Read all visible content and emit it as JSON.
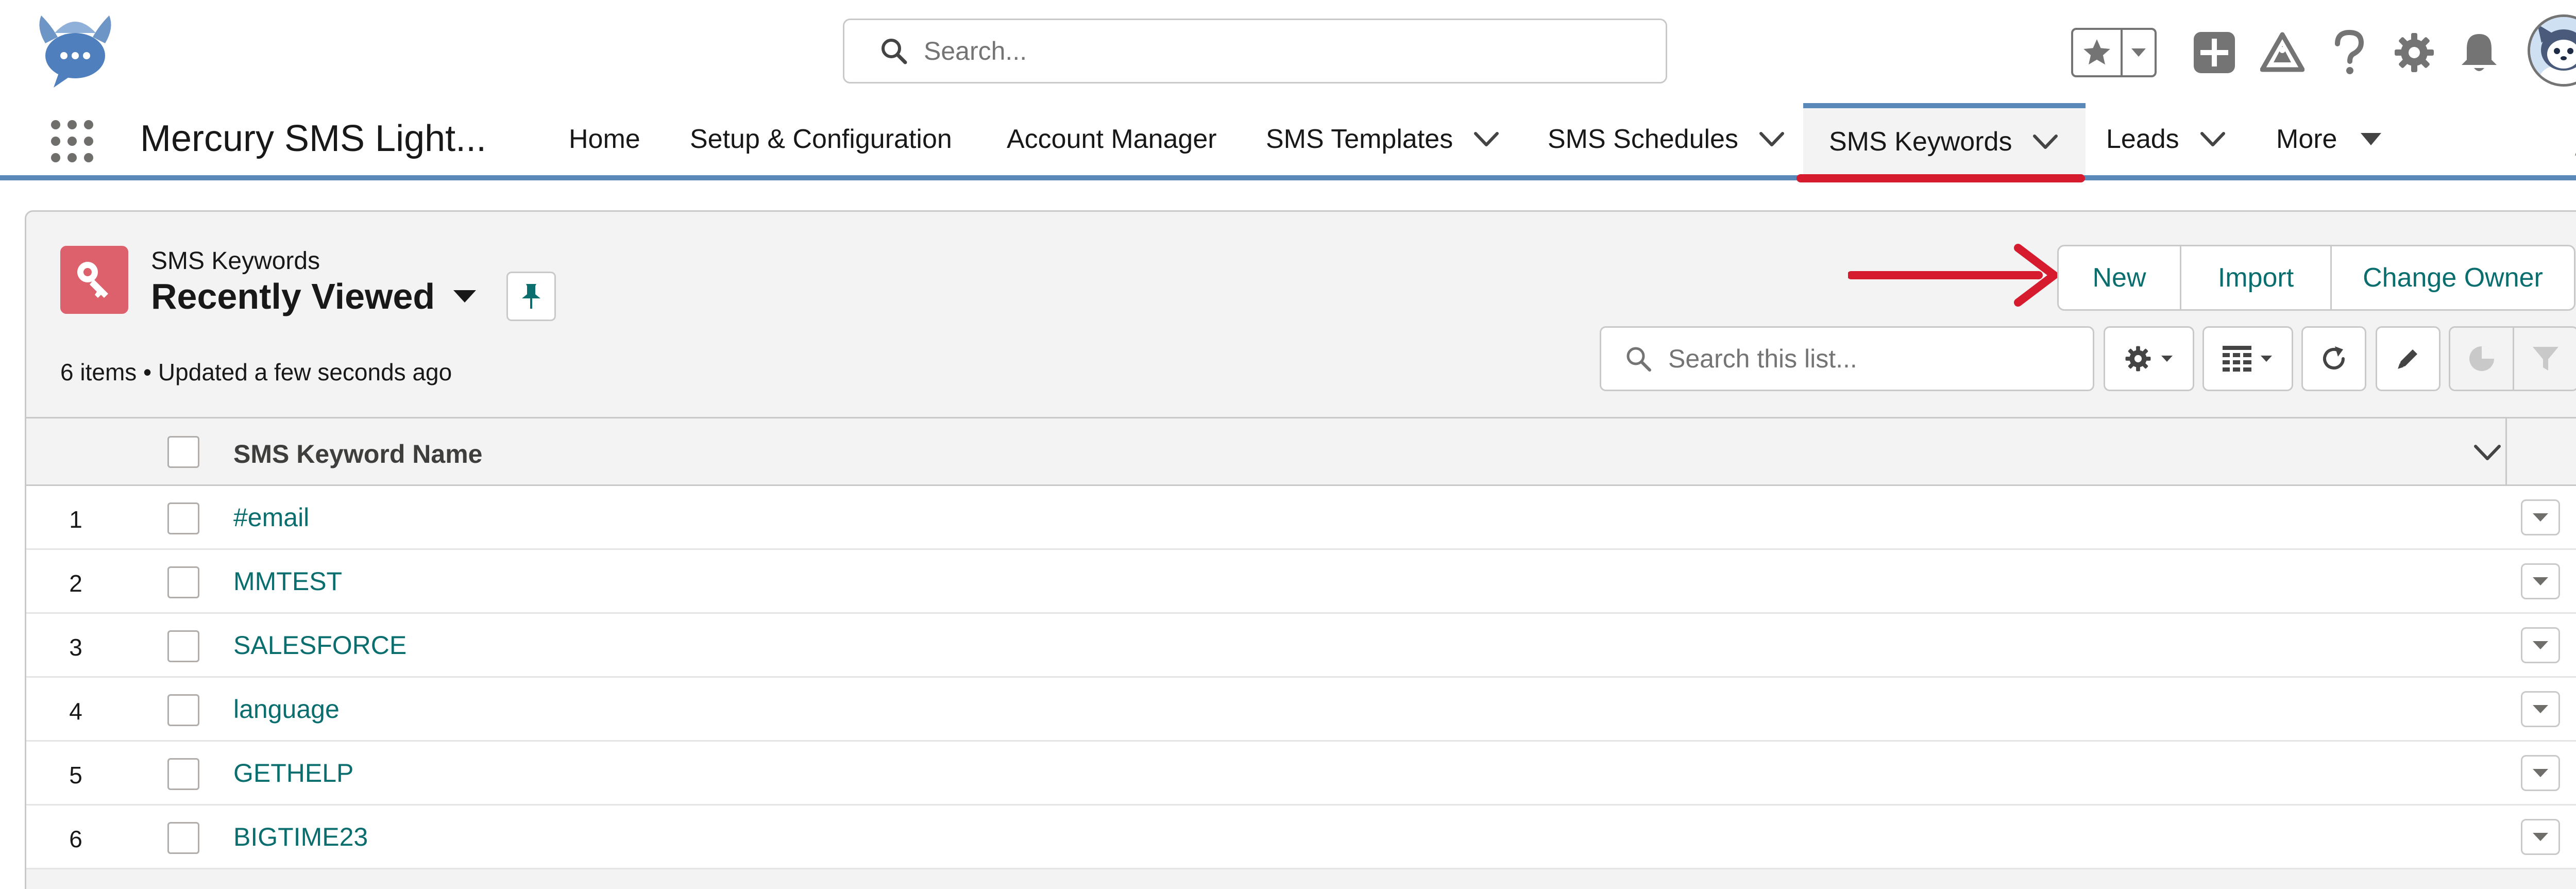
{
  "header": {
    "search_placeholder": "Search..."
  },
  "nav": {
    "app_name": "Mercury SMS Light...",
    "items": [
      {
        "label": "Home"
      },
      {
        "label": "Setup & Configuration"
      },
      {
        "label": "Account Manager"
      },
      {
        "label": "SMS Templates"
      },
      {
        "label": "SMS Schedules"
      },
      {
        "label": "SMS Keywords"
      },
      {
        "label": "Leads"
      },
      {
        "label": "More"
      }
    ],
    "active_item": "SMS Keywords"
  },
  "list_view": {
    "object_label": "SMS Keywords",
    "title": "Recently Viewed",
    "meta": "6 items • Updated a few seconds ago",
    "buttons": {
      "new": "New",
      "import": "Import",
      "change_owner": "Change Owner"
    },
    "search_placeholder": "Search this list...",
    "column_header": "SMS Keyword Name",
    "rows": [
      {
        "num": "1",
        "name": "#email"
      },
      {
        "num": "2",
        "name": "MMTEST"
      },
      {
        "num": "3",
        "name": "SALESFORCE"
      },
      {
        "num": "4",
        "name": "language"
      },
      {
        "num": "5",
        "name": "GETHELP"
      },
      {
        "num": "6",
        "name": "BIGTIME23"
      }
    ]
  },
  "colors": {
    "brand_blue": "#5a88b9",
    "highlight_red": "#d61b2f",
    "link_teal": "#0b6e6e",
    "object_icon": "#dd606d"
  },
  "icons": {
    "logo": "winged-chat-bubble-logo",
    "search": "search-icon",
    "favorites": "star-icon",
    "global_actions": "plus-icon",
    "trailhead": "trailhead-icon",
    "help": "help-icon",
    "setup": "gear-icon",
    "notifications": "bell-icon",
    "object": "key-icon"
  }
}
